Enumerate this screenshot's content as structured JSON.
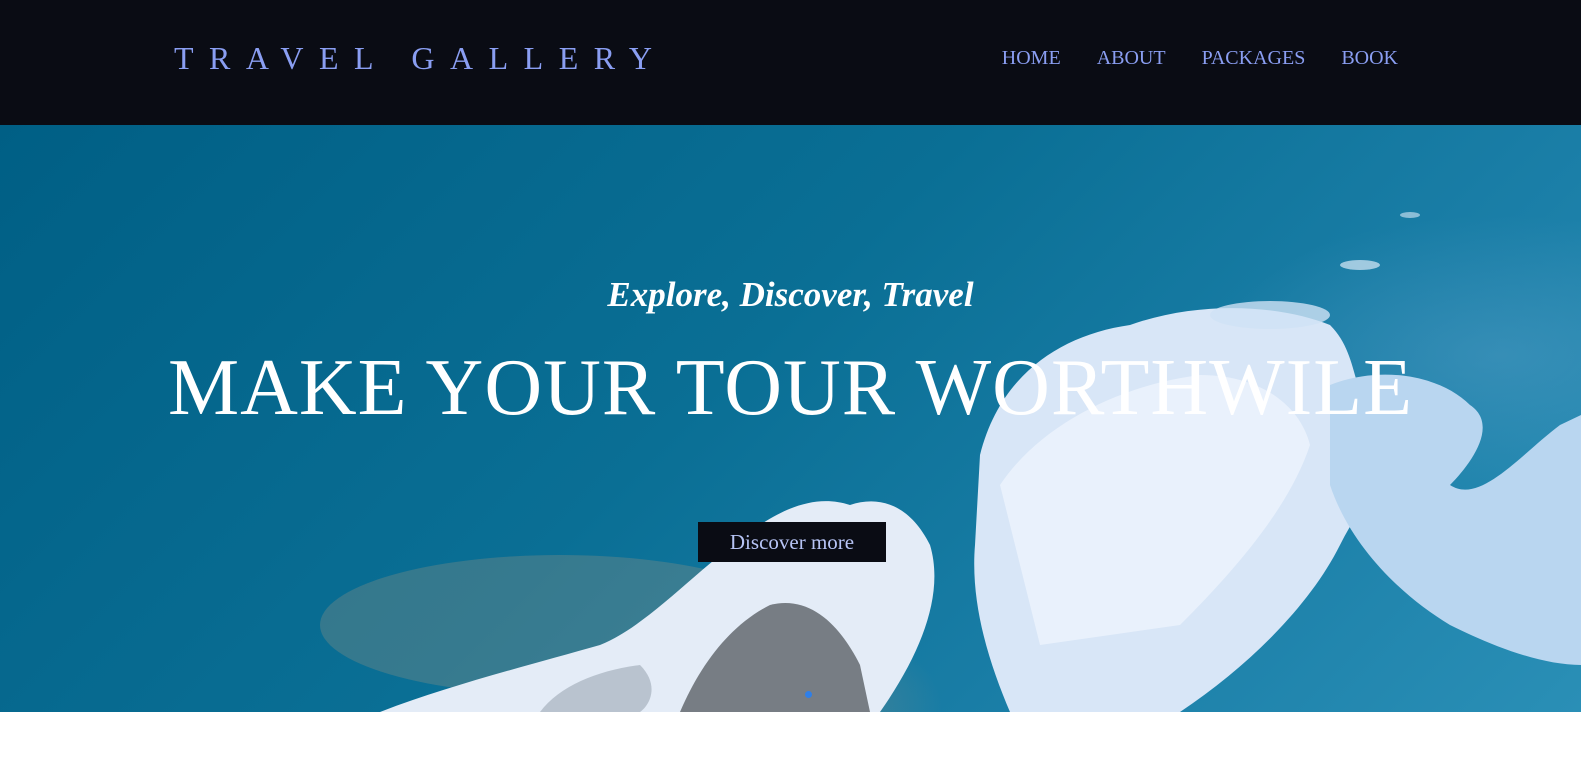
{
  "header": {
    "brand": "TRAVEL GALLERY",
    "nav": [
      {
        "label": "HOME"
      },
      {
        "label": "ABOUT"
      },
      {
        "label": "PACKAGES"
      },
      {
        "label": "BOOK"
      }
    ]
  },
  "hero": {
    "tagline": "Explore, Discover, Travel",
    "headline": "MAKE YOUR TOUR WORTHWILE",
    "cta_label": "Discover more",
    "background_image": "ice-floes-in-blue-water"
  },
  "colors": {
    "navbar_bg": "#0a0c14",
    "nav_text": "#8a9ef2",
    "hero_text": "#ffffff",
    "button_bg": "#0a0c14",
    "button_text": "#b7c4f5",
    "indicator": "#2f7fe8"
  }
}
